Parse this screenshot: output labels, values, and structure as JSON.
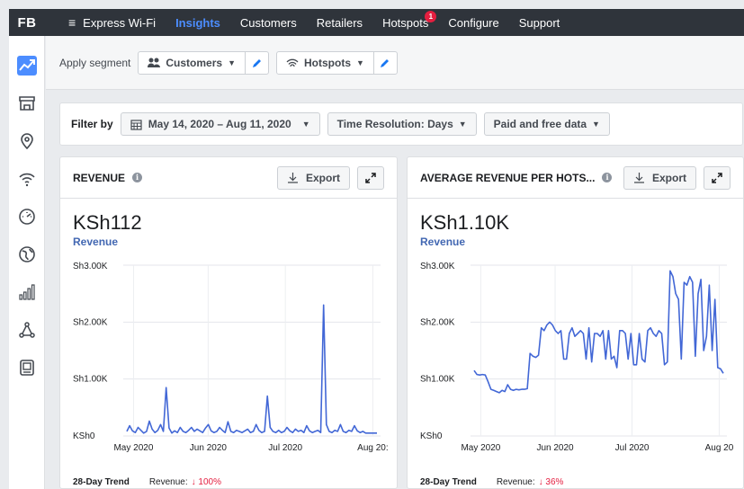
{
  "app": {
    "logo": "FB",
    "brand": "Express Wi-Fi"
  },
  "nav": {
    "items": [
      {
        "label": "Insights",
        "active": true
      },
      {
        "label": "Customers"
      },
      {
        "label": "Retailers"
      },
      {
        "label": "Hotspots",
        "badge": "1"
      },
      {
        "label": "Configure"
      },
      {
        "label": "Support"
      }
    ]
  },
  "sidebar": {
    "icons": [
      "trend-icon",
      "store-icon",
      "location-icon",
      "wifi-icon",
      "dashboard-icon",
      "globe-icon",
      "bar-chart-icon",
      "network-icon",
      "device-icon"
    ]
  },
  "segment": {
    "label": "Apply segment",
    "customers": "Customers",
    "hotspots": "Hotspots"
  },
  "filter": {
    "label": "Filter by",
    "date_range": "May 14, 2020 – Aug 11, 2020",
    "resolution": "Time Resolution: Days",
    "data_type": "Paid and free data"
  },
  "cards": {
    "revenue": {
      "title": "REVENUE",
      "export": "Export",
      "value": "KSh112",
      "sub": "Revenue",
      "trend_label": "28-Day Trend",
      "trend_metric": "Revenue:",
      "trend_value": "↓ 100%"
    },
    "arph": {
      "title": "AVERAGE REVENUE PER HOTS...",
      "export": "Export",
      "value": "KSh1.10K",
      "sub": "Revenue",
      "trend_label": "28-Day Trend",
      "trend_metric": "Revenue:",
      "trend_value": "↓ 36%"
    }
  },
  "colors": {
    "accent": "#4c8dff",
    "line": "#4267d6",
    "topbar": "#2f343b",
    "down": "#e41e3f"
  },
  "chart_data": [
    {
      "type": "line",
      "name": "revenue",
      "y_tick_labels": [
        "KSh0",
        "Sh1.00K",
        "Sh2.00K",
        "Sh3.00K"
      ],
      "x_tick_labels": [
        "May 2020",
        "Jun 2020",
        "Jul 2020",
        "Aug 20:"
      ],
      "ylim": [
        0,
        3000
      ],
      "x_start": "2020-05-14",
      "x_end": "2020-08-11",
      "values": [
        80,
        180,
        90,
        60,
        150,
        100,
        50,
        80,
        260,
        120,
        60,
        100,
        200,
        80,
        850,
        140,
        50,
        90,
        60,
        150,
        80,
        60,
        100,
        150,
        80,
        120,
        90,
        60,
        140,
        200,
        90,
        60,
        80,
        150,
        100,
        60,
        250,
        80,
        60,
        100,
        80,
        60,
        90,
        120,
        60,
        80,
        200,
        100,
        60,
        80,
        700,
        150,
        80,
        60,
        100,
        60,
        80,
        150,
        90,
        60,
        120,
        80,
        100,
        60,
        180,
        90,
        60,
        80,
        100,
        60,
        2300,
        200,
        80,
        60,
        100,
        80,
        200,
        80,
        60,
        100,
        80,
        180,
        90,
        60,
        80,
        50,
        50,
        50,
        50,
        50
      ]
    },
    {
      "type": "line",
      "name": "arph",
      "y_tick_labels": [
        "KSh0",
        "Sh1.00K",
        "Sh2.00K",
        "Sh3.00K"
      ],
      "x_tick_labels": [
        "May 2020",
        "Jun 2020",
        "Jul 2020",
        "Aug 20"
      ],
      "ylim": [
        0,
        3000
      ],
      "x_start": "2020-05-14",
      "x_end": "2020-08-11",
      "values": [
        1150,
        1080,
        1070,
        1080,
        1070,
        950,
        820,
        800,
        780,
        760,
        800,
        780,
        900,
        820,
        800,
        820,
        810,
        820,
        820,
        830,
        1450,
        1400,
        1380,
        1420,
        1900,
        1850,
        1950,
        2000,
        1950,
        1850,
        1800,
        1850,
        1350,
        1350,
        1800,
        1900,
        1750,
        1800,
        1850,
        1800,
        1350,
        1900,
        1300,
        1800,
        1800,
        1750,
        1850,
        1350,
        1850,
        1350,
        1400,
        1200,
        1850,
        1850,
        1800,
        1350,
        1800,
        1250,
        1250,
        1800,
        1350,
        1300,
        1850,
        1900,
        1800,
        1750,
        1850,
        1800,
        1250,
        1300,
        2900,
        2800,
        2500,
        2400,
        1350,
        2700,
        2650,
        2800,
        2700,
        1400,
        2500,
        2750,
        1500,
        1750,
        2650,
        1500,
        2400,
        1200,
        1180,
        1100
      ]
    }
  ]
}
